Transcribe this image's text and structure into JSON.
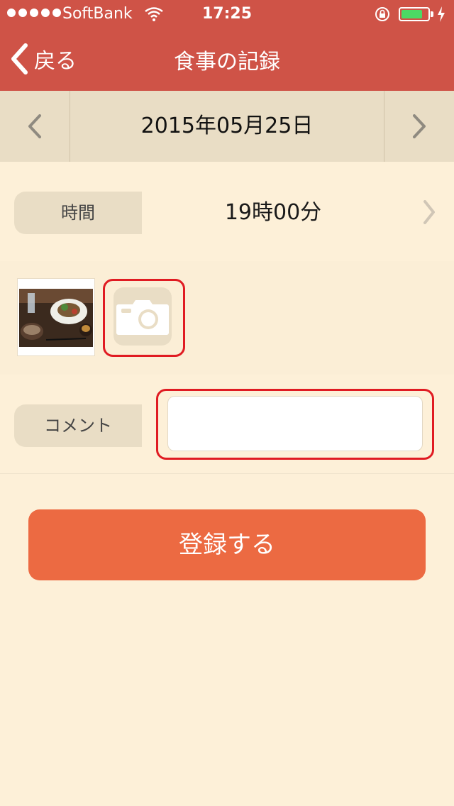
{
  "status_bar": {
    "carrier": "SoftBank",
    "time": "17:25",
    "battery_level": 0.8
  },
  "nav": {
    "back_label": "戻る",
    "title": "食事の記録"
  },
  "date_bar": {
    "date": "2015年05月25日"
  },
  "time_row": {
    "label": "時間",
    "value": "19時00分"
  },
  "comment_row": {
    "label": "コメント",
    "value": ""
  },
  "submit": {
    "label": "登録する"
  },
  "colors": {
    "header": "#cf5347",
    "background": "#fdf0d8",
    "pill": "#e9ddc5",
    "accent_button": "#ec6a42",
    "highlight": "#e01b22"
  }
}
